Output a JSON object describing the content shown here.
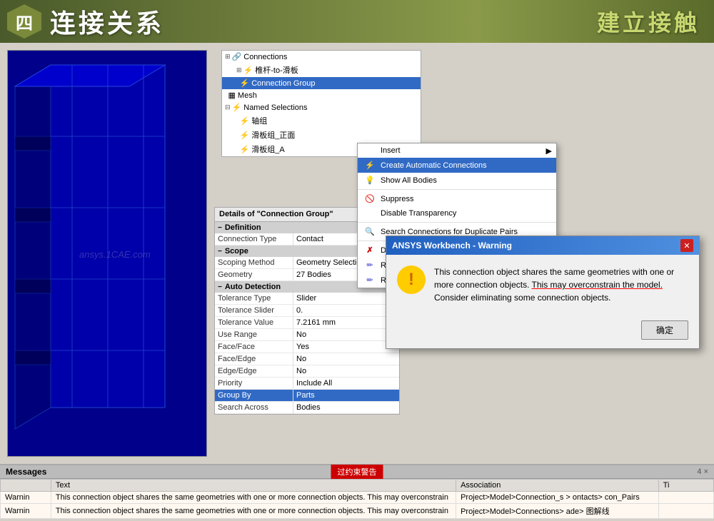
{
  "header": {
    "badge": "四",
    "title_cn": "连接关系",
    "title_right_cn": "建立接触"
  },
  "tree": {
    "items": [
      {
        "id": "connections",
        "label": "Connections",
        "level": 0,
        "expand": "⊞",
        "icon": "🔗"
      },
      {
        "id": "conn1",
        "label": "椎杆-to-滑板",
        "level": 1,
        "expand": "⊞",
        "icon": "⚡"
      },
      {
        "id": "conn_group",
        "label": "Connection Group",
        "level": 1,
        "expand": "",
        "icon": "⚡",
        "selected": true
      },
      {
        "id": "mesh",
        "label": "Mesh",
        "level": 0,
        "expand": "",
        "icon": "▦"
      },
      {
        "id": "named_sel",
        "label": "Named Selections",
        "level": 0,
        "expand": "⊟",
        "icon": "⚡"
      },
      {
        "id": "zhouzu",
        "label": "轴组",
        "level": 1,
        "expand": "",
        "icon": "⚡"
      },
      {
        "id": "huaban",
        "label": "滑板组_正面",
        "level": 1,
        "expand": "",
        "icon": "⚡"
      },
      {
        "id": "huaban2",
        "label": "滑板组_A",
        "level": 1,
        "expand": "",
        "icon": "⚡"
      }
    ]
  },
  "context_menu": {
    "items": [
      {
        "id": "insert",
        "label": "Insert",
        "icon": "",
        "has_arrow": true
      },
      {
        "id": "create_auto",
        "label": "Create Automatic Connections",
        "icon": "⚡",
        "highlighted": true
      },
      {
        "id": "show_all_bodies",
        "label": "Show All Bodies",
        "icon": "💡"
      },
      {
        "id": "separator1",
        "type": "separator"
      },
      {
        "id": "suppress",
        "label": "Suppress",
        "icon": "🚫"
      },
      {
        "id": "disable_trans",
        "label": "Disable Transparency",
        "icon": ""
      },
      {
        "id": "separator2",
        "type": "separator"
      },
      {
        "id": "search_dup",
        "label": "Search Connections for Duplicate Pairs",
        "icon": "🔍"
      },
      {
        "id": "separator3",
        "type": "separator"
      },
      {
        "id": "delete",
        "label": "Delete",
        "icon": "✗"
      },
      {
        "id": "rename",
        "label": "Rename (F2)",
        "icon": "✏"
      },
      {
        "id": "rename_def",
        "label": "Rename Based on Definition",
        "icon": "✏"
      }
    ]
  },
  "details": {
    "title": "Details of \"Connection Group\"",
    "pin": "📌",
    "sections": [
      {
        "name": "Definition",
        "rows": [
          {
            "label": "Connection Type",
            "value": "Contact"
          }
        ]
      },
      {
        "name": "Scope",
        "rows": [
          {
            "label": "Scoping Method",
            "value": "Geometry Selection"
          },
          {
            "label": "Geometry",
            "value": "27 Bodies"
          }
        ]
      },
      {
        "name": "Auto Detection",
        "rows": [
          {
            "label": "Tolerance Type",
            "value": "Slider"
          },
          {
            "label": "Tolerance Slider",
            "value": "0."
          },
          {
            "label": "Tolerance Value",
            "value": "7.2161 mm"
          },
          {
            "label": "Use Range",
            "value": "No"
          },
          {
            "label": "Face/Face",
            "value": "Yes"
          },
          {
            "label": "Face/Edge",
            "value": "No"
          },
          {
            "label": "Edge/Edge",
            "value": "No"
          },
          {
            "label": "Priority",
            "value": "Include All"
          },
          {
            "label": "Group By",
            "value": "Parts",
            "highlighted": true
          },
          {
            "label": "Search Across",
            "value": "Bodies"
          }
        ]
      }
    ]
  },
  "warning_dialog": {
    "title": "ANSYS Workbench - Warning",
    "message_line1": "This connection object shares the same geometries with one or",
    "message_line2": "more connection objects.",
    "message_underline": "This may overconstrain the model.",
    "message_line3": "Consider eliminating some connection objects.",
    "ok_label": "确定"
  },
  "messages": {
    "title": "Messages",
    "badge": "过约束警告",
    "controls": "4 ×",
    "columns": [
      "",
      "Text",
      "Association",
      "Ti"
    ],
    "rows": [
      {
        "type": "Warnin",
        "text": "This connection object shares the same geometries with one or more connection objects. This may overconstrain",
        "assoc": "Project>Model>Connection_s >  ontacts> con_Pairs"
      },
      {
        "type": "Warnin",
        "text": "This connection object shares the same geometries with one or more connection objects. This may overconstrain",
        "assoc": "Project>Model>Connections>  ade>  图解线"
      }
    ]
  }
}
